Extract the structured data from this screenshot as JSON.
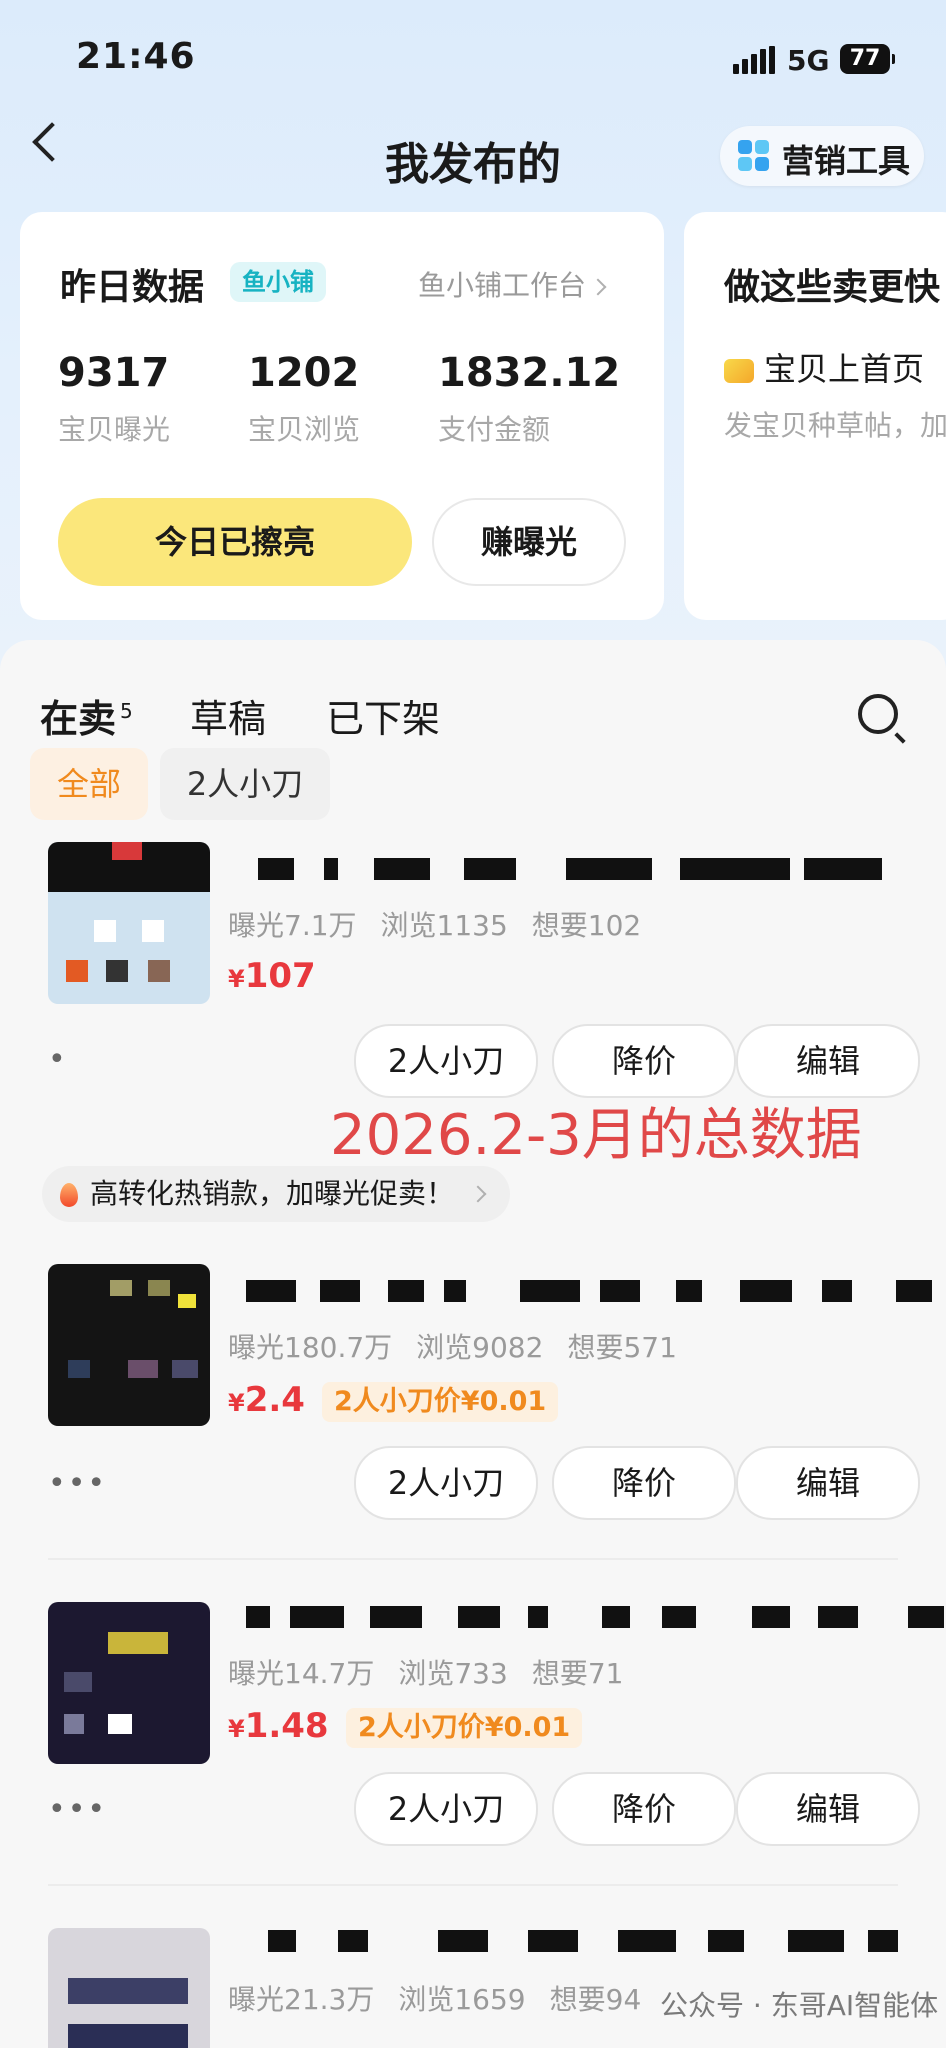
{
  "status_bar": {
    "time": "21:46",
    "network": "5G",
    "battery": "77"
  },
  "nav": {
    "title": "我发布的",
    "marketing_tools": "营销工具"
  },
  "stats_card": {
    "title": "昨日数据",
    "badge": "鱼小铺",
    "workbench_link": "鱼小铺工作台",
    "stats": [
      {
        "value": "9317",
        "label": "宝贝曝光"
      },
      {
        "value": "1202",
        "label": "宝贝浏览"
      },
      {
        "value": "1832.12",
        "label": "支付金额"
      }
    ],
    "polish_button": "今日已擦亮",
    "exposure_button": "赚曝光"
  },
  "promo_card": {
    "title": "做这些卖更快",
    "item": "宝贝上首页",
    "subtitle": "发宝贝种草帖，加"
  },
  "tabs": [
    {
      "label": "在卖",
      "count": "5"
    },
    {
      "label": "草稿"
    },
    {
      "label": "已下架"
    }
  ],
  "filters": [
    "全部",
    "2人小刀"
  ],
  "items": [
    {
      "exposure": "曝光7.1万",
      "views": "浏览1135",
      "wants": "想要102",
      "currency": "¥",
      "price": "107",
      "more": "•"
    },
    {
      "exposure": "曝光180.7万",
      "views": "浏览9082",
      "wants": "想要571",
      "currency": "¥",
      "price": "2.4",
      "deal": "2人小刀价¥0.01",
      "more": "•••"
    },
    {
      "exposure": "曝光14.7万",
      "views": "浏览733",
      "wants": "想要71",
      "currency": "¥",
      "price": "1.48",
      "deal": "2人小刀价¥0.01",
      "more": "•••"
    },
    {
      "exposure": "曝光21.3万",
      "views": "浏览1659",
      "wants": "想要94"
    }
  ],
  "actions": {
    "knife": "2人小刀",
    "lower_price": "降价",
    "edit": "编辑"
  },
  "hot_tip": "高转化热销款，加曝光促卖！",
  "overlay_text": "2026.2-3月的总数据",
  "watermark": "公众号 · 东哥AI智能体",
  "colors": {
    "accent_yellow": "#fbe77b",
    "price_red": "#e8383d",
    "badge_teal": "#17b3c2"
  }
}
